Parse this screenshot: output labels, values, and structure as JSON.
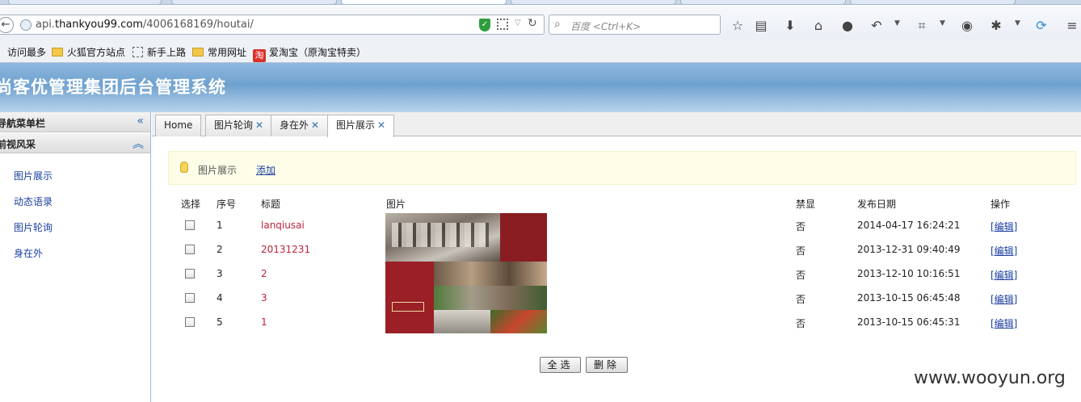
{
  "browser": {
    "url_prefix": "api.",
    "url_host": "thankyou99.com",
    "url_path": "/4006168169/houtai/",
    "search_placeholder": "百度 <Ctrl+K>"
  },
  "bookmarks": [
    {
      "label": "访问最多"
    },
    {
      "label": "火狐官方站点"
    },
    {
      "label": "新手上路"
    },
    {
      "label": "常用网址"
    },
    {
      "label": "爱淘宝（原淘宝特卖）"
    }
  ],
  "app": {
    "title": "尚客优管理集团后台管理系统"
  },
  "sidebar": {
    "nav_header": "导航菜单栏",
    "section_header": "前视风采",
    "items": [
      {
        "label": "图片展示"
      },
      {
        "label": "动态语录"
      },
      {
        "label": "图片轮询"
      },
      {
        "label": "身在外"
      }
    ]
  },
  "tabs": [
    {
      "label": "Home",
      "closable": false
    },
    {
      "label": "图片轮询",
      "closable": true
    },
    {
      "label": "身在外",
      "closable": true
    },
    {
      "label": "图片展示",
      "closable": true,
      "active": true
    }
  ],
  "toolbar": {
    "page_label": "图片展示",
    "add_label": "添加"
  },
  "table": {
    "headers": {
      "select": "选择",
      "index": "序号",
      "title": "标题",
      "image": "图片",
      "disabled": "禁显",
      "date": "发布日期",
      "actions": "操作"
    },
    "rows": [
      {
        "index": "1",
        "title": "lanqiusai",
        "disabled": "否",
        "date": "2014-04-17 16:24:21",
        "action": "[编辑]"
      },
      {
        "index": "2",
        "title": "20131231",
        "disabled": "否",
        "date": "2013-12-31 09:40:49",
        "action": "[编辑]"
      },
      {
        "index": "3",
        "title": "2",
        "disabled": "否",
        "date": "2013-12-10 10:16:51",
        "action": "[编辑]"
      },
      {
        "index": "4",
        "title": "3",
        "disabled": "否",
        "date": "2013-10-15 06:45:48",
        "action": "[编辑]"
      },
      {
        "index": "5",
        "title": "1",
        "disabled": "否",
        "date": "2013-10-15 06:45:31",
        "action": "[编辑]"
      }
    ]
  },
  "buttons": {
    "select_all": "全选",
    "delete": "删除"
  },
  "watermark": "www.wooyun.org",
  "colors": {
    "header_blue": "#6fa1cf",
    "link_blue": "#1a3ea0",
    "title_red": "#c0223e",
    "tip_bg": "#fdfde8"
  }
}
